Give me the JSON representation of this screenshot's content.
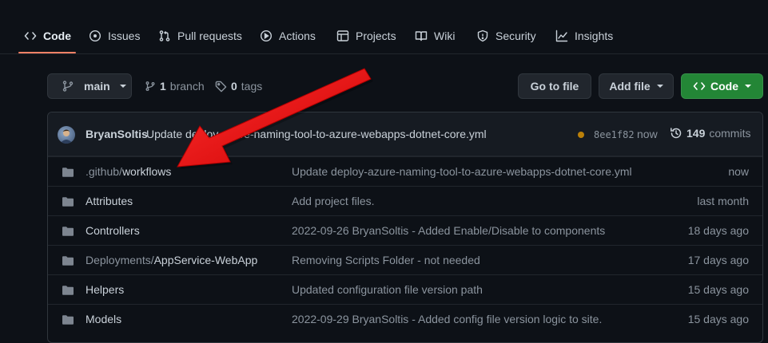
{
  "nav": {
    "tabs": [
      {
        "label": "Code",
        "icon": "code-icon",
        "active": true
      },
      {
        "label": "Issues",
        "icon": "issue-opened-icon"
      },
      {
        "label": "Pull requests",
        "icon": "git-pull-request-icon"
      },
      {
        "label": "Actions",
        "icon": "play-icon"
      },
      {
        "label": "Projects",
        "icon": "table-icon"
      },
      {
        "label": "Wiki",
        "icon": "book-icon"
      },
      {
        "label": "Security",
        "icon": "shield-icon"
      },
      {
        "label": "Insights",
        "icon": "graph-icon"
      }
    ]
  },
  "toolbar": {
    "branch_selector": "main",
    "branch_count": "1",
    "branch_label": "branch",
    "tag_count": "0",
    "tag_label": "tags",
    "go_to_file": "Go to file",
    "add_file": "Add file",
    "code_button": "Code"
  },
  "commit": {
    "author": "BryanSoltis",
    "message": "Update deploy-azure-naming-tool-to-azure-webapps-dotnet-core.yml",
    "sha": "8ee1f82",
    "time": "now",
    "count": "149",
    "count_label": "commits"
  },
  "files": [
    {
      "prefix": ".github/",
      "name": "workflows",
      "message": "Update deploy-azure-naming-tool-to-azure-webapps-dotnet-core.yml",
      "age": "now"
    },
    {
      "prefix": "",
      "name": "Attributes",
      "message": "Add project files.",
      "age": "last month"
    },
    {
      "prefix": "",
      "name": "Controllers",
      "message": "2022-09-26 BryanSoltis - Added Enable/Disable to components",
      "age": "18 days ago"
    },
    {
      "prefix": "Deployments/",
      "name": "AppService-WebApp",
      "message": "Removing Scripts Folder - not needed",
      "age": "17 days ago"
    },
    {
      "prefix": "",
      "name": "Helpers",
      "message": "Updated configuration file version path",
      "age": "15 days ago"
    },
    {
      "prefix": "",
      "name": "Models",
      "message": "2022-09-29 BryanSoltis - Added config file version logic to site.",
      "age": "15 days ago"
    }
  ],
  "colors": {
    "background": "#0d1117",
    "accent_underline": "#f78166",
    "green_button": "#238636",
    "folder": "#7d8590",
    "annotation_arrow": "#e00000"
  }
}
